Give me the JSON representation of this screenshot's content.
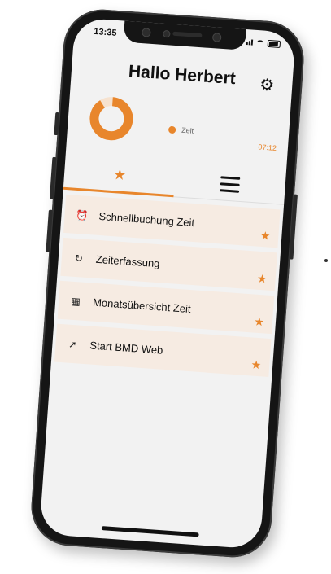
{
  "status_bar": {
    "time": "13:35"
  },
  "header": {
    "greeting": "Hallo Herbert",
    "settings_icon": "gear-icon"
  },
  "summary": {
    "legend_label": "Zeit",
    "time_value": "07:12",
    "donut_fill_fraction": 0.9,
    "accent_color": "#e8862c",
    "track_color": "#f6e2cf"
  },
  "tabs": [
    {
      "name": "favorites",
      "icon": "star-icon",
      "glyph": "★",
      "active": true
    },
    {
      "name": "menu",
      "icon": "hamburger-menu-icon",
      "active": false
    }
  ],
  "favorites": [
    {
      "label": "Schnellbuchung Zeit",
      "icon": "alarm-clock-icon",
      "glyph": "⏰"
    },
    {
      "label": "Zeiterfassung",
      "icon": "refresh-clock-icon",
      "glyph": "↻"
    },
    {
      "label": "Monatsübersicht Zeit",
      "icon": "calendar-icon",
      "glyph": "▦"
    },
    {
      "label": "Start BMD Web",
      "icon": "pointer-icon",
      "glyph": "➚"
    }
  ],
  "star_glyph": "★"
}
